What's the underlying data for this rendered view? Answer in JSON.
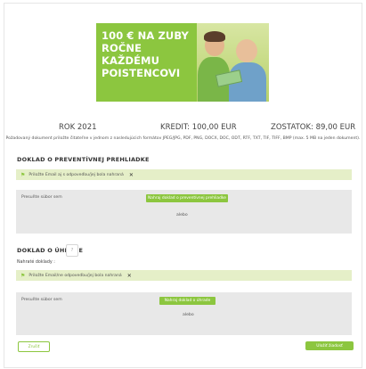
{
  "banner": {
    "line1": "100 € NA ZUBY",
    "line2": "ROČNE KAŽDÉMU",
    "line3": "POISTENCOVI"
  },
  "stats": {
    "year": "ROK 2021",
    "credit": "KREDIT: 100,00 EUR",
    "balance": "ZOSTATOK: 89,00 EUR"
  },
  "note": "Požadovaný dokument priložte čitateľne v jednom z nasledujúcich formátov JPEG/JPG, PDF, PNG, DOCX, DOC, ODT, RTF, TXT, TIF, TIFF, BMP (max. 5 MB na jeden dokument).",
  "preventive": {
    "title": "DOKLAD O PREVENTÍVNEJ PREHLIADKE",
    "uploaded_label": "Nahraté doklady :",
    "alert_text": "Priložte Email aj s odpoveďou/jej bola nahraná",
    "drop_label": "Presuňte súbor sem",
    "upload_button": "Nahraj doklad o preventívnej prehliadke",
    "or_text": "alebo"
  },
  "payment": {
    "title": "DOKLAD O ÚHRADE",
    "info": "?",
    "uploaded_label": "Nahraté doklady :",
    "alert_text": "Priložte Email/ne odpoveďou/jej bola nahraná",
    "drop_label": "Presuňte súbor sem",
    "upload_button": "Nahraj doklad o úhrade",
    "or_text": "alebo"
  },
  "footer": {
    "close_label": "Zrušiť",
    "submit_label": "Uložiť žiadosť"
  },
  "colors": {
    "accent": "#8cc63f",
    "alert_bg": "#e5efc8",
    "dropzone_bg": "#e8e8e8"
  }
}
